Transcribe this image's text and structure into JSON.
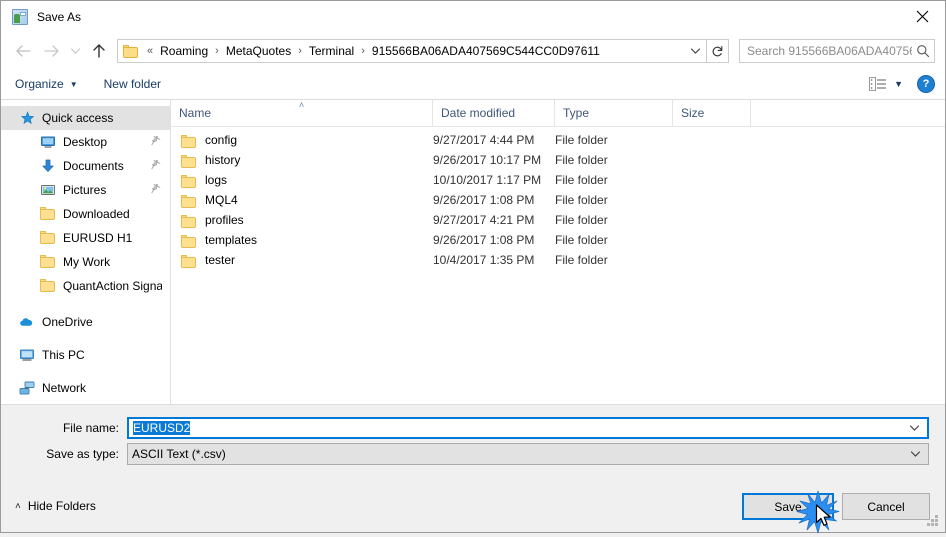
{
  "window": {
    "title": "Save As",
    "icon": "app-icon",
    "close_label": "✕"
  },
  "nav": {
    "back": "←",
    "forward": "→",
    "recent": "∨",
    "up": "↑",
    "breadcrumb_prefix": "«",
    "breadcrumb": [
      "Roaming",
      "MetaQuotes",
      "Terminal",
      "915566BA06ADA407569C544CC0D97611"
    ],
    "breadcrumb_separator": "›",
    "dropdown": "∨",
    "refresh": "↻"
  },
  "search": {
    "placeholder": "Search 915566BA06ADA40756...",
    "icon": "search-icon"
  },
  "toolbar": {
    "organize": "Organize",
    "organize_caret": "▼",
    "new_folder": "New folder",
    "view_icon": "list-view-icon",
    "view_caret": "▼",
    "help": "?"
  },
  "sidebar": {
    "items": [
      {
        "label": "Quick access",
        "icon": "star-icon",
        "level": "root",
        "selected": true,
        "pinned": false
      },
      {
        "label": "Desktop",
        "icon": "monitor-icon",
        "level": "child",
        "selected": false,
        "pinned": true
      },
      {
        "label": "Documents",
        "icon": "download-arrow-icon",
        "level": "child",
        "selected": false,
        "pinned": true
      },
      {
        "label": "Pictures",
        "icon": "picture-icon",
        "level": "child",
        "selected": false,
        "pinned": true
      },
      {
        "label": "Downloaded",
        "icon": "folder-icon",
        "level": "child",
        "selected": false,
        "pinned": false
      },
      {
        "label": "EURUSD H1",
        "icon": "folder-icon",
        "level": "child",
        "selected": false,
        "pinned": false
      },
      {
        "label": "My Work",
        "icon": "folder-icon",
        "level": "child",
        "selected": false,
        "pinned": false
      },
      {
        "label": "QuantAction Signal",
        "icon": "folder-icon",
        "level": "child",
        "selected": false,
        "pinned": false
      },
      {
        "label": "OneDrive",
        "icon": "cloud-icon",
        "level": "root",
        "selected": false,
        "pinned": false
      },
      {
        "label": "This PC",
        "icon": "pc-icon",
        "level": "root",
        "selected": false,
        "pinned": false
      },
      {
        "label": "Network",
        "icon": "network-icon",
        "level": "root",
        "selected": false,
        "pinned": false
      }
    ]
  },
  "filelist": {
    "columns": [
      "Name",
      "Date modified",
      "Type",
      "Size"
    ],
    "sort_column": "Name",
    "sort_caret": "˄",
    "rows": [
      {
        "name": "config",
        "date": "9/27/2017 4:44 PM",
        "type": "File folder",
        "size": ""
      },
      {
        "name": "history",
        "date": "9/26/2017 10:17 PM",
        "type": "File folder",
        "size": ""
      },
      {
        "name": "logs",
        "date": "10/10/2017 1:17 PM",
        "type": "File folder",
        "size": ""
      },
      {
        "name": "MQL4",
        "date": "9/26/2017 1:08 PM",
        "type": "File folder",
        "size": ""
      },
      {
        "name": "profiles",
        "date": "9/27/2017 4:21 PM",
        "type": "File folder",
        "size": ""
      },
      {
        "name": "templates",
        "date": "9/26/2017 1:08 PM",
        "type": "File folder",
        "size": ""
      },
      {
        "name": "tester",
        "date": "10/4/2017 1:35 PM",
        "type": "File folder",
        "size": ""
      }
    ]
  },
  "form": {
    "filename_label": "File name:",
    "filename_value": "EURUSD2",
    "filetype_label": "Save as type:",
    "filetype_value": "ASCII Text (*.csv)",
    "chevron": "∨"
  },
  "footer": {
    "hide_folders": "Hide Folders",
    "hide_chevron": "˄",
    "save": "Save",
    "cancel": "Cancel"
  },
  "colors": {
    "accent": "#0078d7",
    "selection": "#0a7ad4",
    "link": "#1a3c66",
    "column_header": "#40557a",
    "folder": "#ffdf90"
  }
}
